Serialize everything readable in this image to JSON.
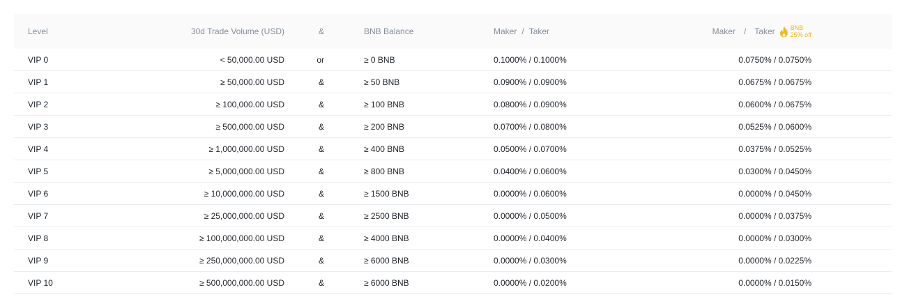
{
  "header": {
    "level": "Level",
    "volume": "30d Trade Volume (USD)",
    "operator": "&",
    "bnb_balance": "BNB Balance",
    "rate_maker": "Maker",
    "rate_sep": "/",
    "rate_taker": "Taker",
    "disc_maker": "Maker",
    "disc_sep": "/",
    "disc_taker": "Taker",
    "badge_line1": "BNB",
    "badge_line2": "25% off",
    "accent_color": "#f0b90b"
  },
  "rows": [
    {
      "level": "VIP 0",
      "volume": "< 50,000.00 USD",
      "op": "or",
      "bnb": "≥ 0 BNB",
      "rate": "0.1000% / 0.1000%",
      "disc": "0.0750% / 0.0750%"
    },
    {
      "level": "VIP 1",
      "volume": "≥ 50,000.00 USD",
      "op": "&",
      "bnb": "≥ 50 BNB",
      "rate": "0.0900% / 0.0900%",
      "disc": "0.0675% / 0.0675%"
    },
    {
      "level": "VIP 2",
      "volume": "≥ 100,000.00 USD",
      "op": "&",
      "bnb": "≥ 100 BNB",
      "rate": "0.0800% / 0.0900%",
      "disc": "0.0600% / 0.0675%"
    },
    {
      "level": "VIP 3",
      "volume": "≥ 500,000.00 USD",
      "op": "&",
      "bnb": "≥ 200 BNB",
      "rate": "0.0700% / 0.0800%",
      "disc": "0.0525% / 0.0600%"
    },
    {
      "level": "VIP 4",
      "volume": "≥ 1,000,000.00 USD",
      "op": "&",
      "bnb": "≥ 400 BNB",
      "rate": "0.0500% / 0.0700%",
      "disc": "0.0375% / 0.0525%"
    },
    {
      "level": "VIP 5",
      "volume": "≥ 5,000,000.00 USD",
      "op": "&",
      "bnb": "≥ 800 BNB",
      "rate": "0.0400% / 0.0600%",
      "disc": "0.0300% / 0.0450%"
    },
    {
      "level": "VIP 6",
      "volume": "≥ 10,000,000.00 USD",
      "op": "&",
      "bnb": "≥ 1500 BNB",
      "rate": "0.0000% / 0.0600%",
      "disc": "0.0000% / 0.0450%"
    },
    {
      "level": "VIP 7",
      "volume": "≥ 25,000,000.00 USD",
      "op": "&",
      "bnb": "≥ 2500 BNB",
      "rate": "0.0000% / 0.0500%",
      "disc": "0.0000% / 0.0375%"
    },
    {
      "level": "VIP 8",
      "volume": "≥ 100,000,000.00 USD",
      "op": "&",
      "bnb": "≥ 4000 BNB",
      "rate": "0.0000% / 0.0400%",
      "disc": "0.0000% / 0.0300%"
    },
    {
      "level": "VIP 9",
      "volume": "≥ 250,000,000.00 USD",
      "op": "&",
      "bnb": "≥ 6000 BNB",
      "rate": "0.0000% / 0.0300%",
      "disc": "0.0000% / 0.0225%"
    },
    {
      "level": "VIP 10",
      "volume": "≥ 500,000,000.00 USD",
      "op": "&",
      "bnb": "≥ 6000 BNB",
      "rate": "0.0000% / 0.0200%",
      "disc": "0.0000% / 0.0150%"
    }
  ]
}
